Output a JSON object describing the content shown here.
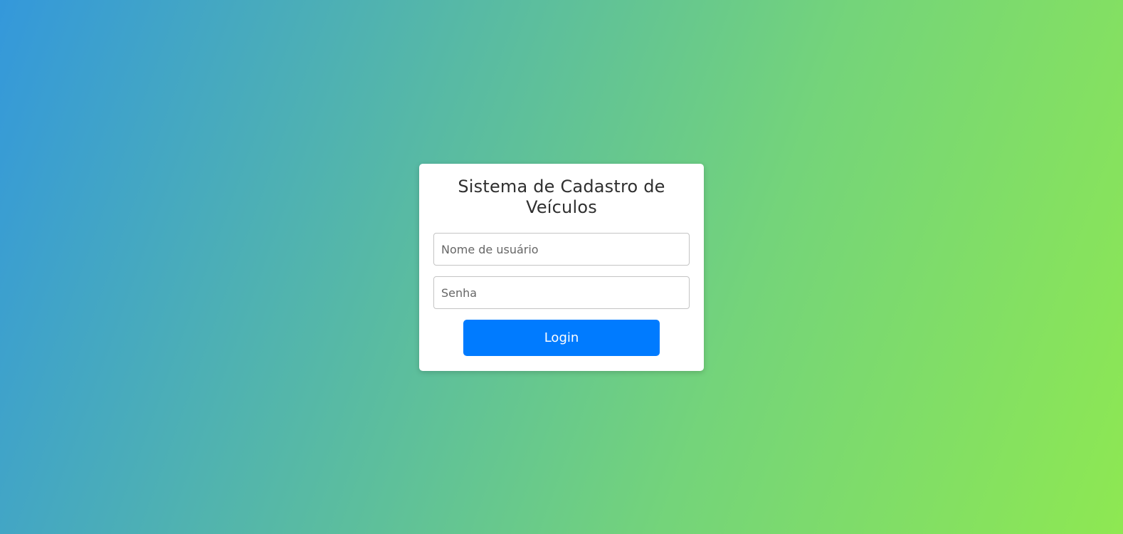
{
  "login": {
    "title": "Sistema de Cadastro de Veículos",
    "username_placeholder": "Nome de usuário",
    "username_value": "",
    "password_placeholder": "Senha",
    "password_value": "",
    "button_label": "Login"
  },
  "colors": {
    "background_gradient_start": "#3498db",
    "background_gradient_end": "#8ee852",
    "card_background": "#ffffff",
    "button_background": "#007bff",
    "button_text": "#ffffff",
    "title_text": "#2f2f2f"
  }
}
